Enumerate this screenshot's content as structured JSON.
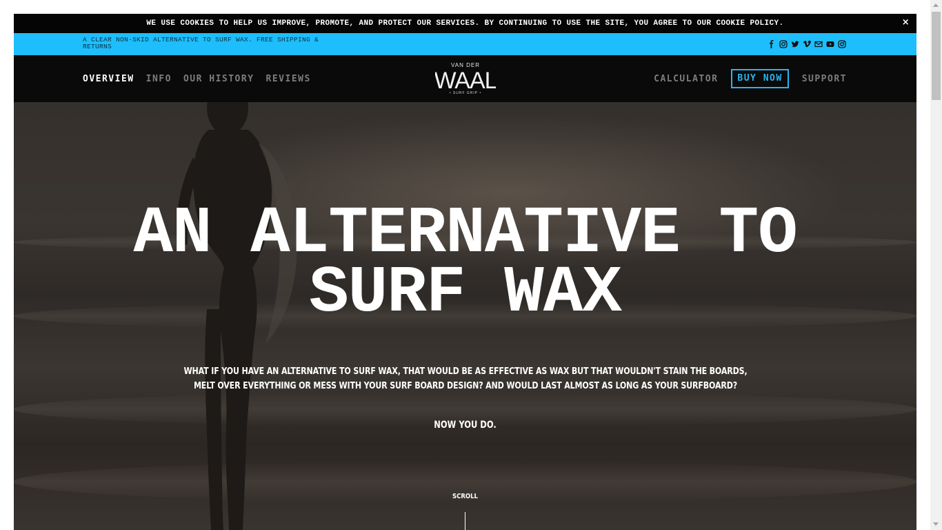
{
  "cookie_bar": {
    "text": "WE USE COOKIES TO HELP US IMPROVE, PROMOTE, AND PROTECT OUR SERVICES. BY CONTINUING TO USE THE SITE, YOU AGREE TO OUR COOKIE POLICY.",
    "close_label": "×"
  },
  "announcement": {
    "text": "A CLEAR NON-SKID ALTERNATIVE TO SURF WAX. FREE SHIPPING & RETURNS",
    "social_icons": [
      "facebook-icon",
      "instagram-icon",
      "twitter-icon",
      "vimeo-icon",
      "email-icon",
      "youtube-icon",
      "instagram-icon"
    ]
  },
  "nav": {
    "left": [
      "OVERVIEW",
      "INFO",
      "OUR HISTORY",
      "REVIEWS"
    ],
    "right": [
      "CALCULATOR",
      "BUY NOW",
      "SUPPORT"
    ],
    "active": "OVERVIEW"
  },
  "logo": {
    "top_text": "VAN DER",
    "main_text": "WAAL",
    "bottom_text": "• SURF GRIP •"
  },
  "hero": {
    "title_line1": "AN ALTERNATIVE TO",
    "title_line2": "SURF WAX",
    "subtitle": "WHAT IF YOU HAVE AN ALTERNATIVE TO SURF WAX, THAT WOULD BE AS EFFECTIVE AS WAX BUT THAT WOULDN'T STAIN THE BOARDS, MELT OVER EVERYTHING OR MESS WITH YOUR SURF BOARD DESIGN? AND WOULD LAST ALMOST AS LONG AS YOUR SURFBOARD?",
    "subtitle2": "NOW YOU DO.",
    "scroll_label": "SCROLL"
  },
  "colors": {
    "accent": "#1dbefb",
    "cookie_bg": "#050505",
    "nav_bg": "#0a0a0a"
  }
}
